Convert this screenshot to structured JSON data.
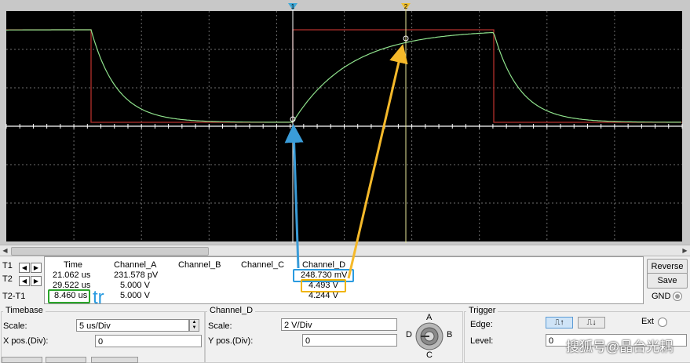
{
  "colors": {
    "screen_bg": "#000000",
    "grid": "#6e6e6e",
    "square_wave": "#b3302c",
    "decay_wave": "#8fe28c",
    "cursor_t1": "#ffffff",
    "cursor_t2": "#e8e89a",
    "marker_t1": "#3fa9d8",
    "marker_t2": "#f0c030",
    "highlight_green": "#2aa52a",
    "highlight_blue": "#2a9be0",
    "highlight_yellow": "#f0b400",
    "arrow_blue": "#3a9cd8",
    "arrow_yellow": "#f5b92a"
  },
  "cursors": {
    "t1_label": "1",
    "t2_label": "2"
  },
  "measure": {
    "headers": [
      "Time",
      "Channel_A",
      "Channel_B",
      "Channel_C",
      "Channel_D"
    ],
    "rows": [
      {
        "label": "T1",
        "time": "21.062 us",
        "ch_a": "231.578 pV",
        "ch_b": "",
        "ch_c": "",
        "ch_d": "248.730 mV"
      },
      {
        "label": "T2",
        "time": "29.522 us",
        "ch_a": "5.000 V",
        "ch_b": "",
        "ch_c": "",
        "ch_d": "4.493 V"
      },
      {
        "label": "T2-T1",
        "time": "8.460 us",
        "ch_a": "5.000 V",
        "ch_b": "",
        "ch_c": "",
        "ch_d": "4.244 V"
      }
    ],
    "annotation": "tr"
  },
  "buttons": {
    "reverse": "Reverse",
    "save": "Save",
    "gnd": "GND"
  },
  "timebase": {
    "title": "Timebase",
    "scale_label": "Scale:",
    "scale_value": "5 us/Div",
    "xpos_label": "X pos.(Div):",
    "xpos_value": "0"
  },
  "channel": {
    "title": "Channel_D",
    "scale_label": "Scale:",
    "scale_value": "2  V/Div",
    "ypos_label": "Y pos.(Div):",
    "ypos_value": "0",
    "knob_labels": {
      "a": "A",
      "b": "B",
      "c": "C",
      "d": "D"
    }
  },
  "trigger": {
    "title": "Trigger",
    "edge_label": "Edge:",
    "level_label": "Level:",
    "level_value": "0",
    "ext_label": "Ext"
  },
  "watermark": "搜狐号@晶台光耦"
}
